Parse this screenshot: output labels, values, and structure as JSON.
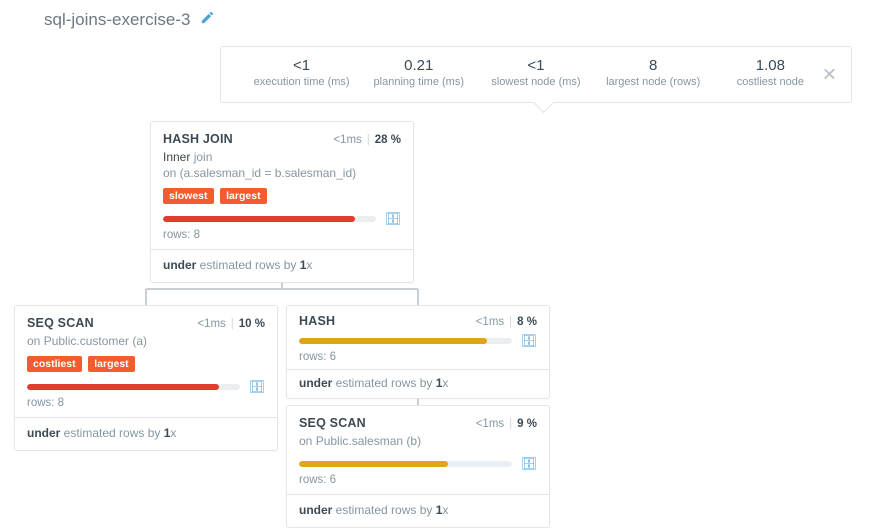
{
  "title": "sql-joins-exercise-3",
  "summary": {
    "close_glyph": "✕",
    "metrics": [
      {
        "value": "<1",
        "label": "execution time (ms)"
      },
      {
        "value": "0.21",
        "label": "planning time (ms)"
      },
      {
        "value": "<1",
        "label": "slowest node (ms)"
      },
      {
        "value": "8",
        "label": "largest node (rows)"
      },
      {
        "value": "1.08",
        "label": "costliest node"
      }
    ]
  },
  "nodes": {
    "hash_join": {
      "name": "HASH JOIN",
      "time": "<1ms",
      "pct": "28 %",
      "sub_kw": "Inner",
      "sub_rest_1": " join",
      "sub_line2": "on (a.salesman_id = b.salesman_id)",
      "tags": [
        "slowest",
        "largest"
      ],
      "bar_color": "red",
      "bar_pct": 90,
      "rows_label": "rows: ",
      "rows_val": "8",
      "est_prefix": "under",
      "est_mid": " estimated rows by ",
      "est_factor": "1",
      "est_x": "x"
    },
    "seq_scan_a": {
      "name": "SEQ SCAN",
      "time": "<1ms",
      "pct": "10 %",
      "sub_prefix": "on ",
      "sub_target": "Public.customer (a)",
      "tags": [
        "costliest",
        "largest"
      ],
      "bar_color": "red",
      "bar_pct": 90,
      "rows_label": "rows: ",
      "rows_val": "8",
      "est_prefix": "under",
      "est_mid": " estimated rows by ",
      "est_factor": "1",
      "est_x": "x"
    },
    "hash": {
      "name": "HASH",
      "time": "<1ms",
      "pct": "8 %",
      "bar_color": "orange",
      "bar_pct": 88,
      "rows_label": "rows: ",
      "rows_val": "6",
      "est_prefix": "under",
      "est_mid": " estimated rows by ",
      "est_factor": "1",
      "est_x": "x"
    },
    "seq_scan_b": {
      "name": "SEQ SCAN",
      "time": "<1ms",
      "pct": "9 %",
      "sub_prefix": "on ",
      "sub_target": "Public.salesman (b)",
      "bar_color": "orange",
      "bar_pct": 70,
      "rows_label": "rows: ",
      "rows_val": "6",
      "est_prefix": "under",
      "est_mid": " estimated rows by ",
      "est_factor": "1",
      "est_x": "x"
    }
  },
  "icons": {
    "db": "🗄"
  }
}
